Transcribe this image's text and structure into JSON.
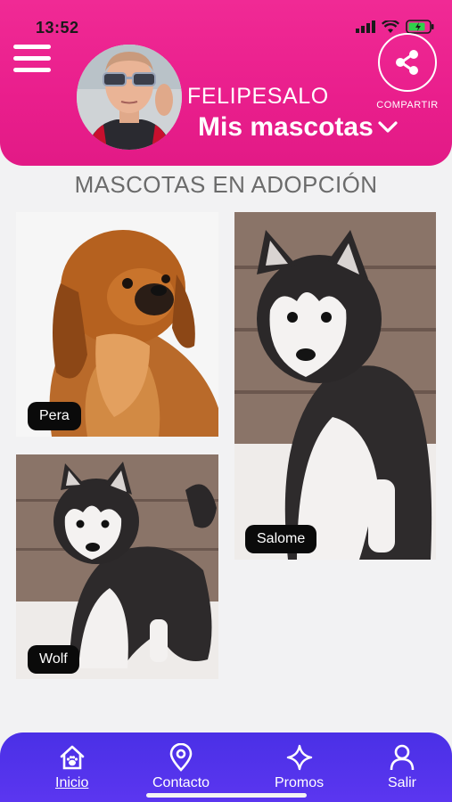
{
  "status_bar": {
    "time": "13:52"
  },
  "header": {
    "username": "FELIPESALO",
    "pets_dropdown_label": "Mis mascotas",
    "share_label": "COMPARTIR",
    "colors": {
      "primary": "#e91e8c",
      "nav": "#5034e8"
    }
  },
  "main": {
    "section_title": "MASCOTAS EN ADOPCIÓN",
    "pets": [
      {
        "name": "Pera"
      },
      {
        "name": "Salome"
      },
      {
        "name": "Wolf"
      }
    ]
  },
  "bottom_nav": {
    "items": [
      {
        "label": "Inicio",
        "icon": "home-paw-icon"
      },
      {
        "label": "Contacto",
        "icon": "location-pin-icon"
      },
      {
        "label": "Promos",
        "icon": "sparkle-icon"
      },
      {
        "label": "Salir",
        "icon": "user-icon"
      }
    ]
  }
}
